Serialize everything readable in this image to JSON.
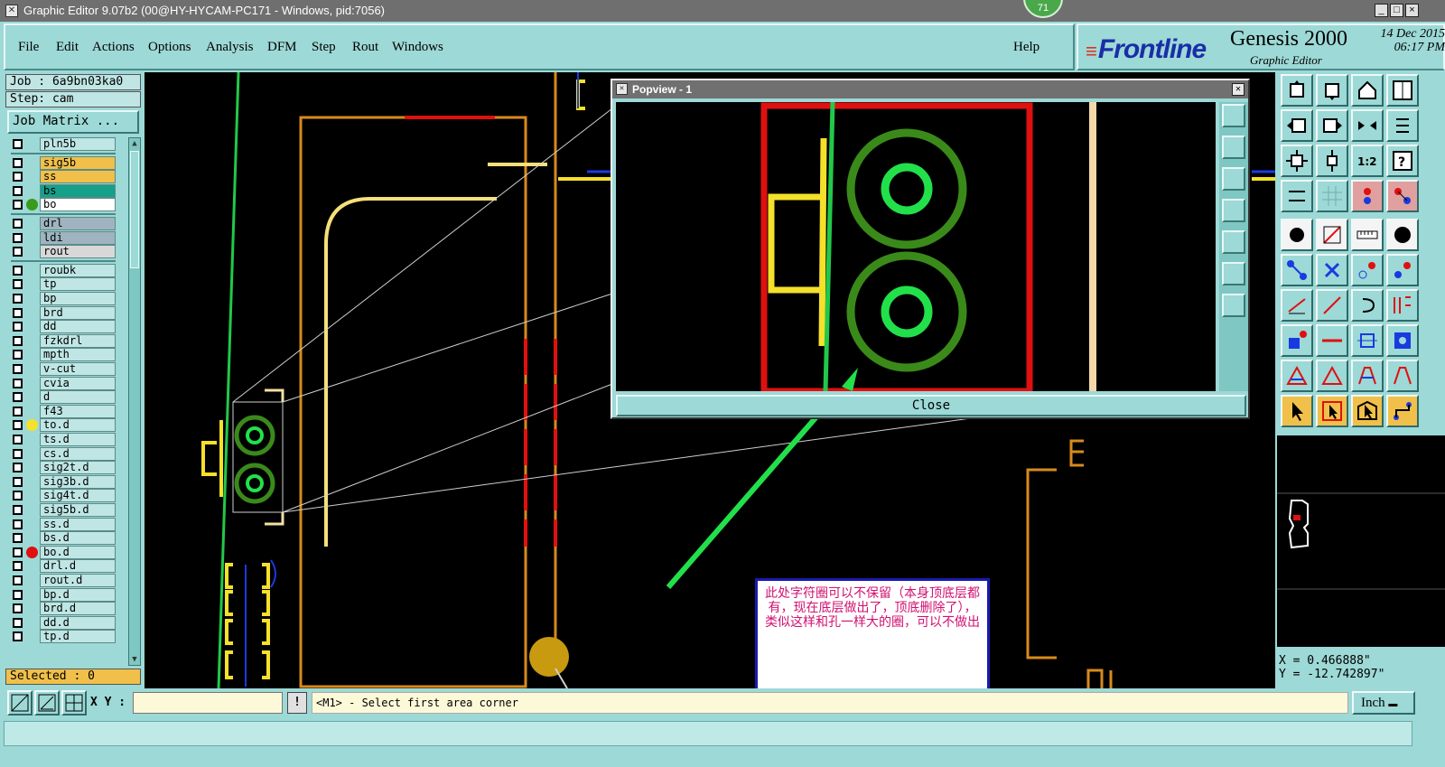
{
  "window": {
    "title": "Graphic Editor 9.07b2 (00@HY-HYCAM-PC171 - Windows, pid:7056)",
    "badge": "71",
    "buttons": [
      "_",
      "□",
      "×"
    ]
  },
  "menu": {
    "items": [
      "File",
      "Edit",
      "Actions",
      "Options",
      "Analysis",
      "DFM",
      "Step",
      "Rout",
      "Windows"
    ],
    "help": "Help"
  },
  "brand": {
    "logo": "Frontline",
    "product": "Genesis 2000",
    "subtitle": "Graphic Editor",
    "date": "14 Dec 2015",
    "time": "06:17 PM"
  },
  "left": {
    "job": "Job : 6a9bn03ka0",
    "step": "Step: cam",
    "job_matrix": "Job Matrix ...",
    "selected": "Selected : 0",
    "layers": [
      {
        "name": "pln5b",
        "color": "#bfe6e4",
        "dot": ""
      },
      {
        "name": "sig5b",
        "color": "#f0c04a",
        "dot": ""
      },
      {
        "name": "ss",
        "color": "#f0c04a",
        "dot": ""
      },
      {
        "name": "bs",
        "color": "#16a08a",
        "dot": ""
      },
      {
        "name": "bo",
        "color": "#ffffff",
        "dot": "#3a9a1a"
      },
      {
        "name": "drl",
        "color": "#9fb4c0",
        "dot": ""
      },
      {
        "name": "ldi",
        "color": "#9fb4c0",
        "dot": ""
      },
      {
        "name": "rout",
        "color": "#d8d8d8",
        "dot": ""
      },
      {
        "name": "roubk",
        "color": "#bfe6e4",
        "dot": ""
      },
      {
        "name": "tp",
        "color": "#bfe6e4",
        "dot": ""
      },
      {
        "name": "bp",
        "color": "#bfe6e4",
        "dot": ""
      },
      {
        "name": "brd",
        "color": "#bfe6e4",
        "dot": ""
      },
      {
        "name": "dd",
        "color": "#bfe6e4",
        "dot": ""
      },
      {
        "name": "fzkdrl",
        "color": "#bfe6e4",
        "dot": ""
      },
      {
        "name": "mpth",
        "color": "#bfe6e4",
        "dot": ""
      },
      {
        "name": "v-cut",
        "color": "#bfe6e4",
        "dot": ""
      },
      {
        "name": "cvia",
        "color": "#bfe6e4",
        "dot": ""
      },
      {
        "name": "d",
        "color": "#bfe6e4",
        "dot": ""
      },
      {
        "name": "f43",
        "color": "#bfe6e4",
        "dot": ""
      },
      {
        "name": "to.d",
        "color": "#bfe6e4",
        "dot": "#f5e02a"
      },
      {
        "name": "ts.d",
        "color": "#bfe6e4",
        "dot": ""
      },
      {
        "name": "cs.d",
        "color": "#bfe6e4",
        "dot": ""
      },
      {
        "name": "sig2t.d",
        "color": "#bfe6e4",
        "dot": ""
      },
      {
        "name": "sig3b.d",
        "color": "#bfe6e4",
        "dot": ""
      },
      {
        "name": "sig4t.d",
        "color": "#bfe6e4",
        "dot": ""
      },
      {
        "name": "sig5b.d",
        "color": "#bfe6e4",
        "dot": ""
      },
      {
        "name": "ss.d",
        "color": "#bfe6e4",
        "dot": ""
      },
      {
        "name": "bs.d",
        "color": "#bfe6e4",
        "dot": ""
      },
      {
        "name": "bo.d",
        "color": "#bfe6e4",
        "dot": "#e01010"
      },
      {
        "name": "drl.d",
        "color": "#bfe6e4",
        "dot": ""
      },
      {
        "name": "rout.d",
        "color": "#bfe6e4",
        "dot": ""
      },
      {
        "name": "bp.d",
        "color": "#bfe6e4",
        "dot": ""
      },
      {
        "name": "brd.d",
        "color": "#bfe6e4",
        "dot": ""
      },
      {
        "name": "dd.d",
        "color": "#bfe6e4",
        "dot": ""
      },
      {
        "name": "tp.d",
        "color": "#bfe6e4",
        "dot": ""
      }
    ]
  },
  "popview": {
    "title": "Popview - 1",
    "close_label": "Close"
  },
  "note": {
    "text": "此处字符圈可以不保留（本身顶底层都有，现在底层做出了，顶底删除了），类似这样和孔一样大的圈，可以不做出"
  },
  "coords": {
    "x": "X = 0.466888\"",
    "y": "Y = -12.742897\""
  },
  "command": {
    "xy_label": "X Y :",
    "xy_value": "",
    "alert": "!",
    "prompt": "<M1> - Select first area corner",
    "unit": "Inch"
  },
  "colors": {
    "panel": "#9dd9d6",
    "canvas": "#000000",
    "highlight_red": "#e01010"
  }
}
